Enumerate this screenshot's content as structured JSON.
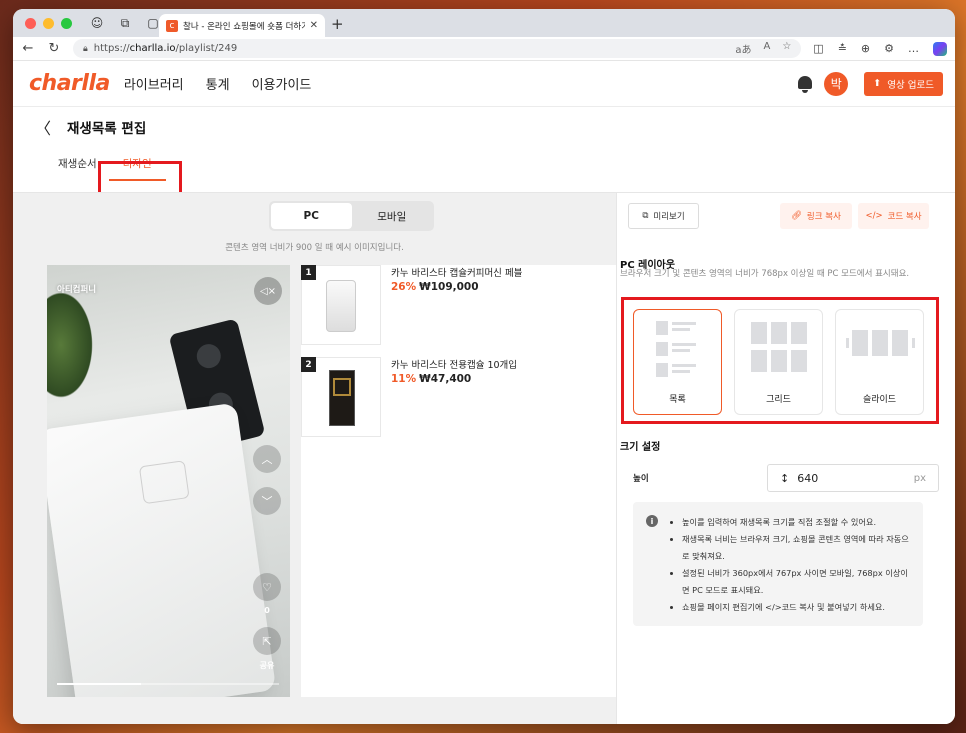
{
  "browser": {
    "tab_title": "찰나 - 온라인 쇼핑몰에 숏폼 더하기",
    "tab_favicon": "c",
    "url_prefix": "https://",
    "url_host": "charlla.io",
    "url_path": "/playlist/249"
  },
  "header": {
    "logo": "charlla",
    "nav": [
      "라이브러리",
      "통계",
      "이용가이드"
    ],
    "avatar": "박",
    "upload_label": "영상 업로드"
  },
  "page": {
    "title": "재생목록 편집",
    "tabs": [
      "재생순서",
      "디자인"
    ],
    "active_tab": "디자인"
  },
  "preview": {
    "modes": [
      "PC",
      "모바일"
    ],
    "active_mode": "PC",
    "note": "콘텐츠 영역 너비가 900 일 때 예시 이미지입니다.",
    "video_label": "아티컴퍼니",
    "like_count": "0",
    "share_label": "공유",
    "products": [
      {
        "rank": "1",
        "name": "카누 바리스타 캡슐커피머신 페블",
        "discount": "26%",
        "price": "₩109,000"
      },
      {
        "rank": "2",
        "name": "카누 바리스타 전용캡슐 10개입",
        "discount": "11%",
        "price": "₩47,400"
      }
    ]
  },
  "panel": {
    "preview_btn": "미리보기",
    "link_copy_btn": "링크 복사",
    "code_copy_btn": "코드 복사",
    "layout_title": "PC 레이아웃",
    "layout_desc": "브라우저 크기 및 콘텐츠 영역의 너비가 768px 이상일 때 PC 모드에서 표시돼요.",
    "layouts": [
      "목록",
      "그리드",
      "슬라이드"
    ],
    "selected_layout": "목록",
    "size_title": "크기 설정",
    "height_label": "높이",
    "height_value": "640",
    "height_unit": "px",
    "info": [
      "높이를 입력하여 재생목록 크기를 직접 조절할 수 있어요.",
      "재생목록 너비는 브라우저 크기, 쇼핑몰 콘텐츠 영역에 따라 자동으로 맞춰져요.",
      "설정된 너비가 360px에서 767px 사이면 모바일, 768px 이상이면 PC 모드로 표시돼요.",
      "쇼핑몰 페이지 편집기에 </>코드 복사 및 붙여넣기 하세요."
    ]
  },
  "colors": {
    "brand": "#f05a28",
    "highlight": "#e4191e"
  }
}
